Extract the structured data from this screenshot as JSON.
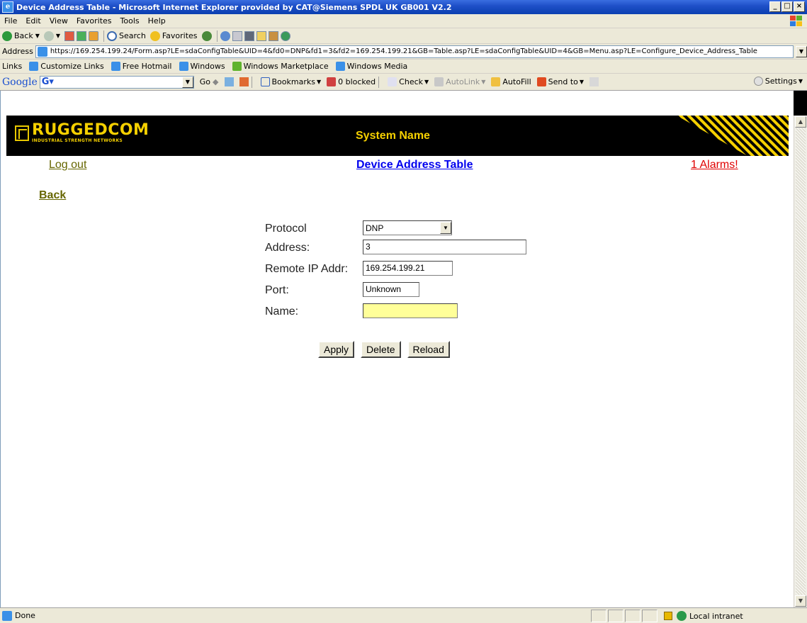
{
  "window": {
    "title": "Device Address Table - Microsoft Internet Explorer provided by CAT@Siemens SPDL UK GB001 V2.2",
    "buttons": [
      "_",
      "□",
      "×"
    ]
  },
  "menu": [
    "File",
    "Edit",
    "View",
    "Favorites",
    "Tools",
    "Help"
  ],
  "toolbar": {
    "back": "Back",
    "search": "Search",
    "favorites": "Favorites"
  },
  "address": {
    "label": "Address",
    "url": "https://169.254.199.24/Form.asp?LE=sdaConfigTable&UID=4&fd0=DNP&fd1=3&fd2=169.254.199.21&GB=Table.asp?LE=sdaConfigTable&UID=4&GB=Menu.asp?LE=Configure_Device_Address_Table"
  },
  "links": {
    "label": "Links",
    "items": [
      "Customize Links",
      "Free Hotmail",
      "Windows",
      "Windows Marketplace",
      "Windows Media"
    ]
  },
  "google": {
    "logo": "Google",
    "go": "Go",
    "bookmarks": "Bookmarks",
    "blocked": "0 blocked",
    "check": "Check",
    "autolink": "AutoLink",
    "autofill": "AutoFill",
    "sendto": "Send to",
    "settings": "Settings"
  },
  "page": {
    "brand_name": "RUGGEDCOM",
    "brand_tagline": "INDUSTRIAL STRENGTH NETWORKS",
    "system_name": "System Name",
    "logout": "Log out",
    "title": "Device Address Table",
    "alarms": "1 Alarms!",
    "back": "Back",
    "form": {
      "protocol_label": "Protocol",
      "protocol_value": "DNP",
      "address_label": "Address:",
      "address_value": "3",
      "remote_ip_label": "Remote IP Addr:",
      "remote_ip_value": "169.254.199.21",
      "port_label": "Port:",
      "port_value": "Unknown",
      "name_label": "Name:",
      "name_value": ""
    },
    "buttons": {
      "apply": "Apply",
      "delete": "Delete",
      "reload": "Reload"
    }
  },
  "status": {
    "text": "Done",
    "zone": "Local intranet"
  },
  "colors": {
    "brand_yellow": "#f5d000",
    "header_black": "#000000",
    "link_olive": "#666600",
    "title_blue": "#0000ee",
    "alarm_red": "#e00000",
    "name_field_bg": "#ffff99"
  }
}
